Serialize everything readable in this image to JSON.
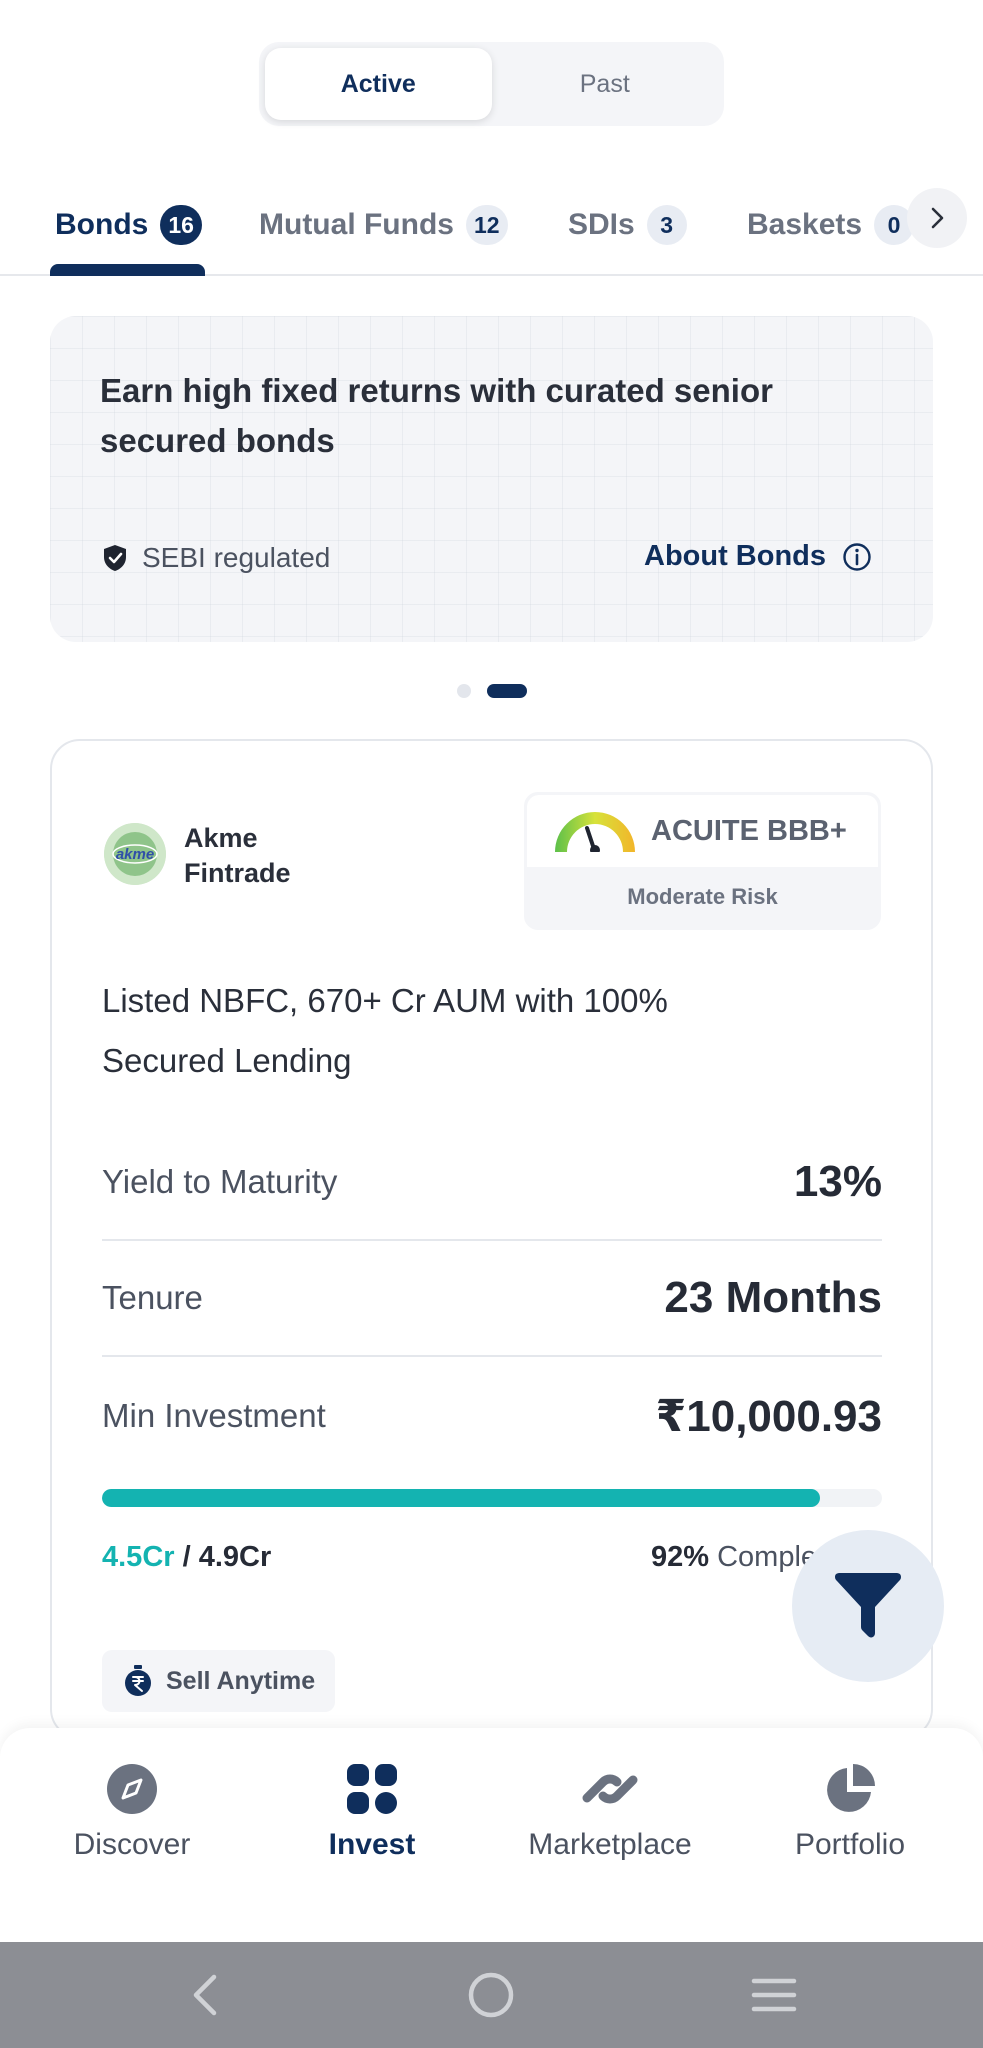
{
  "segment": {
    "active_label": "Active",
    "past_label": "Past"
  },
  "tabs": [
    {
      "label": "Bonds",
      "count": "16"
    },
    {
      "label": "Mutual Funds",
      "count": "12"
    },
    {
      "label": "SDIs",
      "count": "3"
    },
    {
      "label": "Baskets",
      "count": "0"
    }
  ],
  "banner": {
    "title": "Earn high fixed returns with curated senior secured bonds",
    "regulated": "SEBI regulated",
    "about_link": "About Bonds"
  },
  "carousel": {
    "total": 2,
    "active_index": 1
  },
  "bond_card": {
    "issuer": "Akme Fintrade",
    "logo_text": "akme",
    "rating": "ACUITE BBB+",
    "risk": "Moderate Risk",
    "description": "Listed NBFC, 670+ Cr AUM with 100% Secured Lending",
    "ytm_label": "Yield to Maturity",
    "ytm_value": "13%",
    "tenure_label": "Tenure",
    "tenure_value": "23 Months",
    "min_inv_label": "Min Investment",
    "min_inv_value": "₹10,000.93",
    "raised": "4.5Cr",
    "raised_sep": " / ",
    "total": "4.9Cr",
    "percent": "92%",
    "complete_label": " Complete",
    "progress_fraction": 0.92,
    "chip": "Sell Anytime"
  },
  "nav": [
    {
      "label": "Discover",
      "icon": "compass-icon"
    },
    {
      "label": "Invest",
      "icon": "grid-icon"
    },
    {
      "label": "Marketplace",
      "icon": "exchange-icon"
    },
    {
      "label": "Portfolio",
      "icon": "pie-chart-icon"
    }
  ],
  "colors": {
    "primary": "#0f2e5c",
    "accent": "#14b3b1",
    "fab_bg": "#e6ecf4"
  }
}
